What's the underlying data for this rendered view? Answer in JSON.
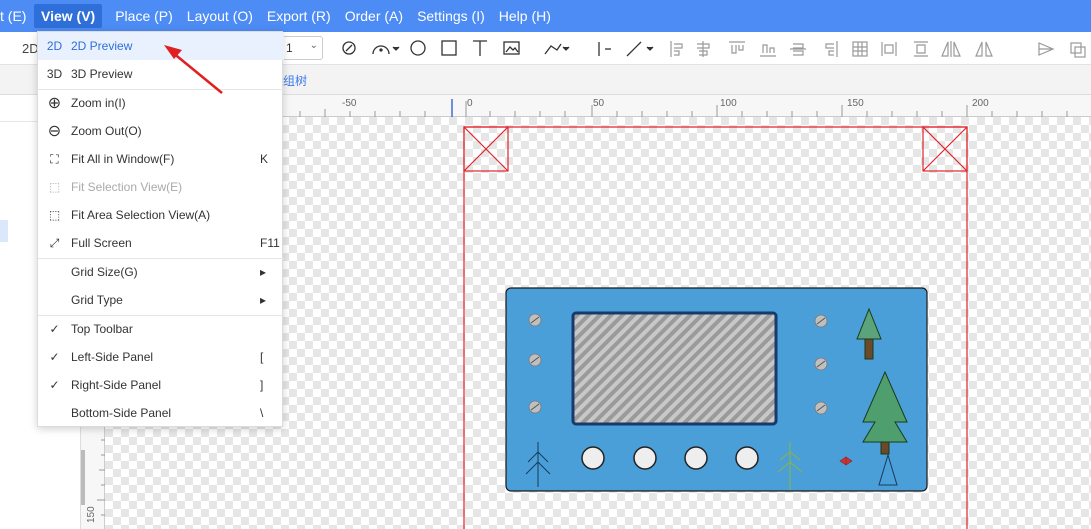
{
  "menubar": {
    "items": [
      {
        "label": "t (E)"
      },
      {
        "label": "View (V)"
      },
      {
        "label": "Place (P)"
      },
      {
        "label": "Layout (O)"
      },
      {
        "label": "Export (R)"
      },
      {
        "label": "Order (A)"
      },
      {
        "label": "Settings (I)"
      },
      {
        "label": "Help (H)"
      }
    ]
  },
  "toolbar": {
    "left_label": "2D",
    "zoom_value": "1"
  },
  "tabstrip": {
    "tab_label": "组树"
  },
  "hruler": {
    "labels": [
      "-50",
      "0",
      "50",
      "100",
      "150",
      "200"
    ]
  },
  "vruler": {
    "label": "150"
  },
  "view_menu": {
    "items": [
      {
        "icon": "2D",
        "label": "2D Preview",
        "shortcut": ""
      },
      {
        "icon": "3D",
        "label": "3D Preview",
        "shortcut": ""
      },
      {
        "icon": "⊕",
        "label": "Zoom in(I)",
        "shortcut": ""
      },
      {
        "icon": "⊖",
        "label": "Zoom Out(O)",
        "shortcut": ""
      },
      {
        "icon": "⛶",
        "label": "Fit All in Window(F)",
        "shortcut": "K"
      },
      {
        "icon": "⬚",
        "label": "Fit Selection View(E)",
        "shortcut": ""
      },
      {
        "icon": "⬚",
        "label": "Fit Area Selection View(A)",
        "shortcut": ""
      },
      {
        "icon": "⤢",
        "label": "Full Screen",
        "shortcut": "F11"
      },
      {
        "icon": "",
        "label": "Grid Size(G)",
        "shortcut": "▸"
      },
      {
        "icon": "",
        "label": "Grid Type",
        "shortcut": "▸"
      },
      {
        "icon": "✓",
        "label": "Top Toolbar",
        "shortcut": ""
      },
      {
        "icon": "✓",
        "label": "Left-Side Panel",
        "shortcut": "["
      },
      {
        "icon": "✓",
        "label": "Right-Side Panel",
        "shortcut": "]"
      },
      {
        "icon": "",
        "label": "Bottom-Side Panel",
        "shortcut": "\\"
      }
    ]
  },
  "colors": {
    "menubar": "#4d8cf5",
    "board": "#4a9fd8",
    "outline": "#e0242b"
  }
}
